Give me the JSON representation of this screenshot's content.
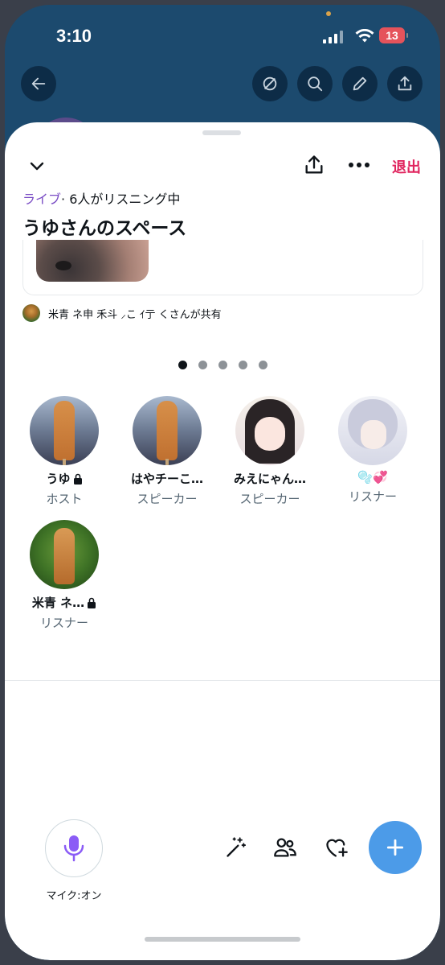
{
  "status_bar": {
    "time": "3:10",
    "battery": "13"
  },
  "sheet": {
    "leave_label": "退出",
    "live_label": "ライブ",
    "listening_text": "· 6人がリスニング中",
    "title": "うゆさんのスペース",
    "shared_by_text": "米青 ネ申 禾斗 ⸝こ ｲ亍 くさんが共有",
    "page_dots": {
      "count": 5,
      "active_index": 0
    }
  },
  "participants": [
    {
      "name": "うゆ",
      "role": "ホスト",
      "locked": true,
      "avatar": "cat-corndog-city"
    },
    {
      "name": "はやチーこ…",
      "role": "スピーカー",
      "locked": false,
      "avatar": "cat-corndog-city"
    },
    {
      "name": "みえにゃん…",
      "role": "スピーカー",
      "locked": false,
      "avatar": "anime-girl-dark-hair"
    },
    {
      "name": "🫧💞",
      "role": "リスナー",
      "locked": false,
      "avatar": "anime-boy-silver-hair"
    },
    {
      "name": "米青 ネ…",
      "role": "リスナー",
      "locked": true,
      "avatar": "cat-corndog-forest"
    }
  ],
  "controls": {
    "mic_label": "マイク:オン"
  },
  "colors": {
    "header_bg": "#1c4a6e",
    "accent_purple": "#794bc4",
    "leave_red": "#e0245e",
    "fab_blue": "#4c9be8"
  }
}
